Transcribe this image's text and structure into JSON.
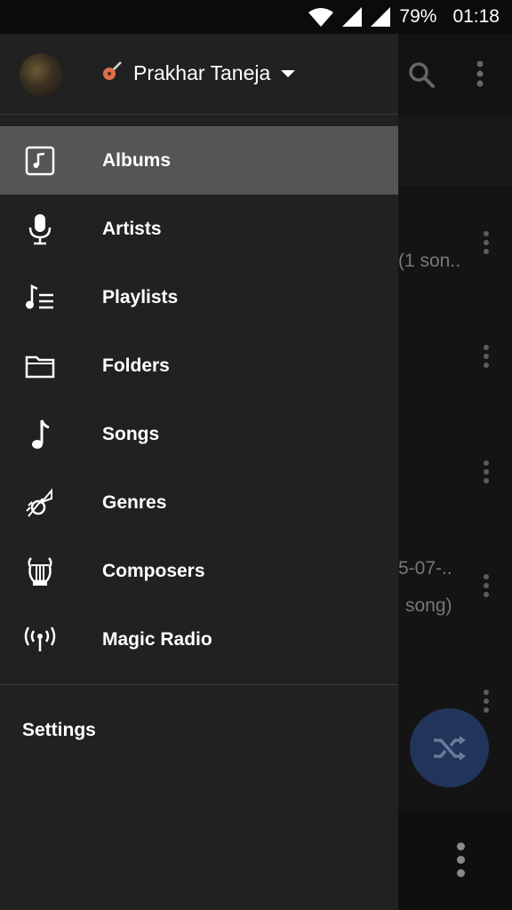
{
  "status_bar": {
    "battery": "79%",
    "time": "01:18"
  },
  "drawer": {
    "account_name": "Prakhar Taneja",
    "items": [
      {
        "label": "Albums",
        "icon": "music-note-box-icon",
        "active": true
      },
      {
        "label": "Artists",
        "icon": "microphone-icon",
        "active": false
      },
      {
        "label": "Playlists",
        "icon": "playlist-icon",
        "active": false
      },
      {
        "label": "Folders",
        "icon": "folder-icon",
        "active": false
      },
      {
        "label": "Songs",
        "icon": "music-note-icon",
        "active": false
      },
      {
        "label": "Genres",
        "icon": "trumpet-icon",
        "active": false
      },
      {
        "label": "Composers",
        "icon": "lyre-icon",
        "active": false
      },
      {
        "label": "Magic Radio",
        "icon": "radio-broadcast-icon",
        "active": false
      }
    ],
    "settings_label": "Settings"
  },
  "background": {
    "text_1": "(1 son..",
    "text_2": "5-07-..",
    "text_3": "song)"
  },
  "colors": {
    "accent_fab": "#22345a",
    "drawer_bg": "#212121",
    "active_row": "#555555"
  }
}
